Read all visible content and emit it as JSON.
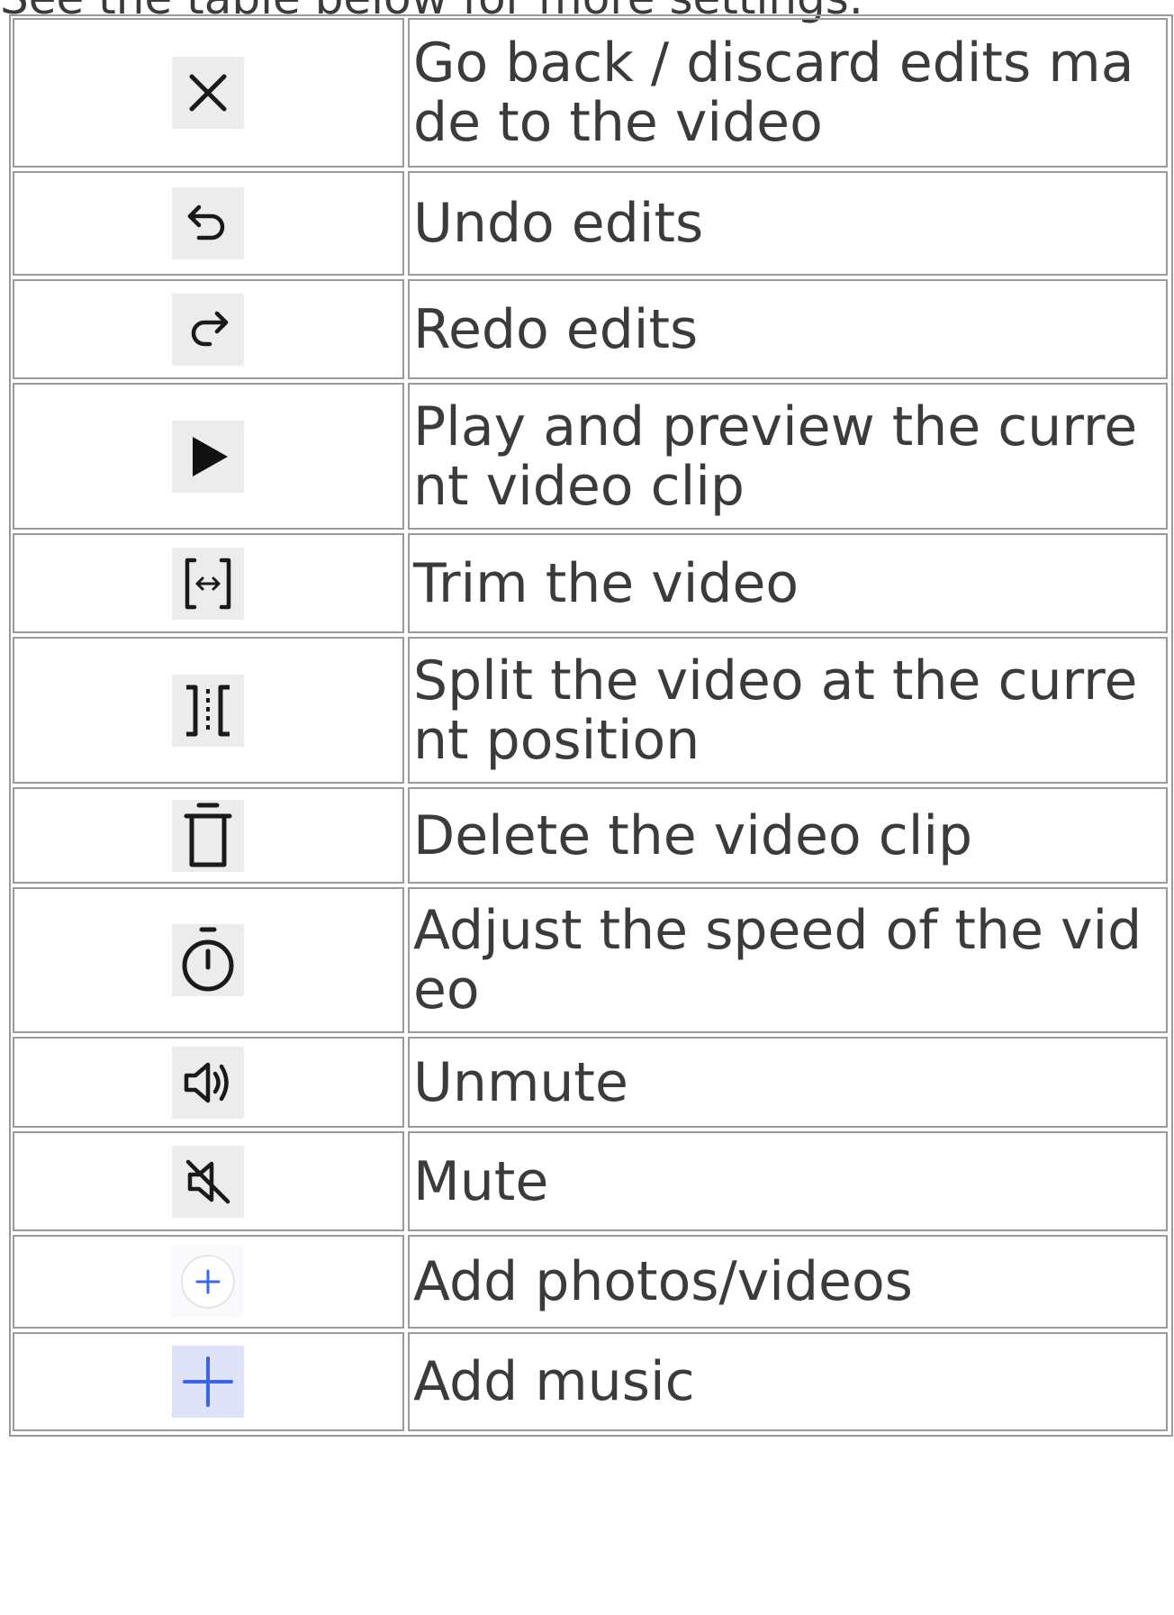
{
  "intro_text": "See the table below for more settings.",
  "rows": [
    {
      "icon": "close-icon",
      "text": "Go back / discard edits made to the video"
    },
    {
      "icon": "undo-icon",
      "text": "Undo edits"
    },
    {
      "icon": "redo-icon",
      "text": "Redo edits"
    },
    {
      "icon": "play-icon",
      "text": "Play and preview the current video clip"
    },
    {
      "icon": "trim-icon",
      "text": "Trim the video"
    },
    {
      "icon": "split-icon",
      "text": "Split the video at the current position"
    },
    {
      "icon": "trash-icon",
      "text": "Delete the video clip"
    },
    {
      "icon": "speed-icon",
      "text": "Adjust the speed of the video"
    },
    {
      "icon": "speaker-icon",
      "text": "Unmute"
    },
    {
      "icon": "mute-icon",
      "text": "Mute"
    },
    {
      "icon": "add-circle-icon",
      "text": "Add photos/videos"
    },
    {
      "icon": "plus-icon",
      "text": "Add music"
    }
  ],
  "colors": {
    "border": "#9a9a9a",
    "text": "#3b3b3b",
    "icon_bg": "#ececed",
    "accent_blue": "#3a63f0"
  }
}
